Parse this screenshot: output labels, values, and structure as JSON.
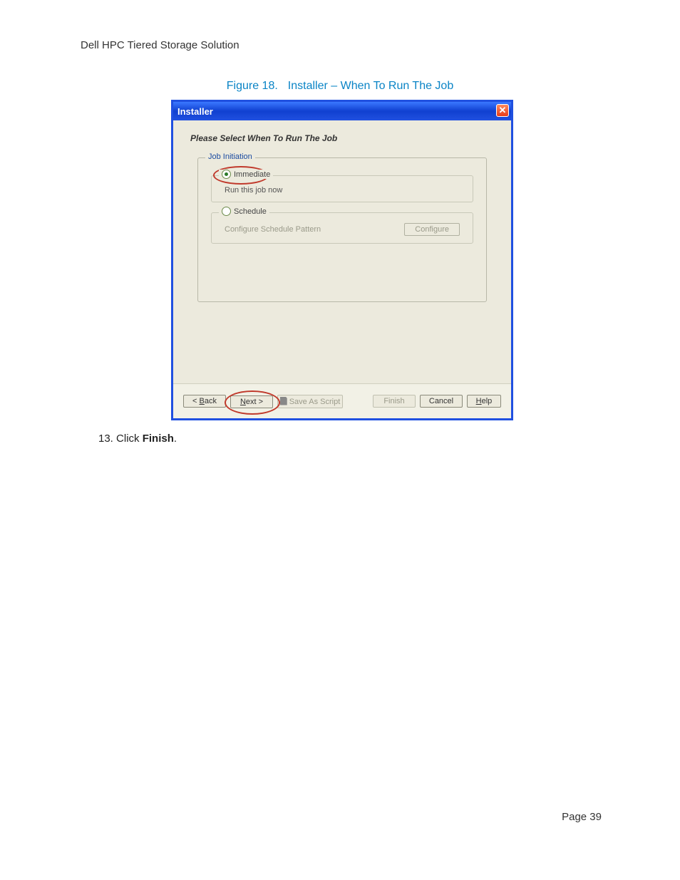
{
  "doc": {
    "header": "Dell HPC Tiered Storage Solution",
    "page_label": "Page 39"
  },
  "figure": {
    "num": "Figure 18.",
    "title": "Installer – When To Run The Job"
  },
  "window": {
    "title": "Installer",
    "close_glyph": "✕",
    "prompt": "Please Select When To Run The Job",
    "groupbox_legend": "Job Initiation",
    "immediate": {
      "label": "Immediate",
      "desc": "Run this job now"
    },
    "schedule": {
      "label": "Schedule",
      "desc": "Configure Schedule Pattern",
      "button": "Configure"
    },
    "buttons": {
      "back_pre": "< ",
      "back_u": "B",
      "back_post": "ack",
      "next_u": "N",
      "next_post": "ext >",
      "save": "Save As Script",
      "finish": "Finish",
      "cancel": "Cancel",
      "help_u": "H",
      "help_post": "elp"
    }
  },
  "step": {
    "num": "13.",
    "pre": " Click ",
    "bold": "Finish",
    "post": "."
  }
}
